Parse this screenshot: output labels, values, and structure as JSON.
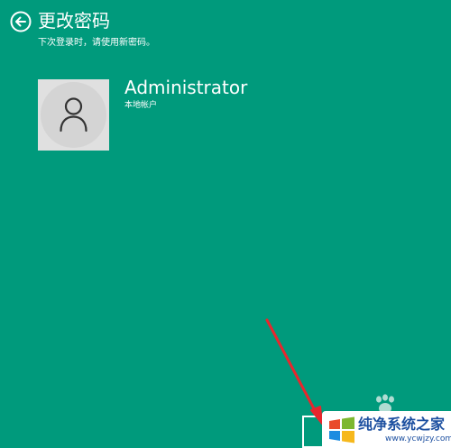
{
  "header": {
    "title": "更改密码",
    "subtitle": "下次登录时，请使用新密码。"
  },
  "account": {
    "name": "Administrator",
    "type": "本地帐户"
  },
  "watermark": {
    "name": "纯净系统之家",
    "url": "www.ycwjzy.com"
  },
  "colors": {
    "background": "#009a7c",
    "text": "#ffffff",
    "avatar_tile": "#e0e0e0",
    "annotation_arrow": "#e8262d",
    "watermark_text": "#1c4fa0"
  },
  "icons": {
    "back": "back-arrow-icon",
    "avatar": "user-icon",
    "annotation": "red-arrow-icon",
    "watermark_paw": "paw-icon",
    "watermark_logo": "windows-logo-icon"
  }
}
